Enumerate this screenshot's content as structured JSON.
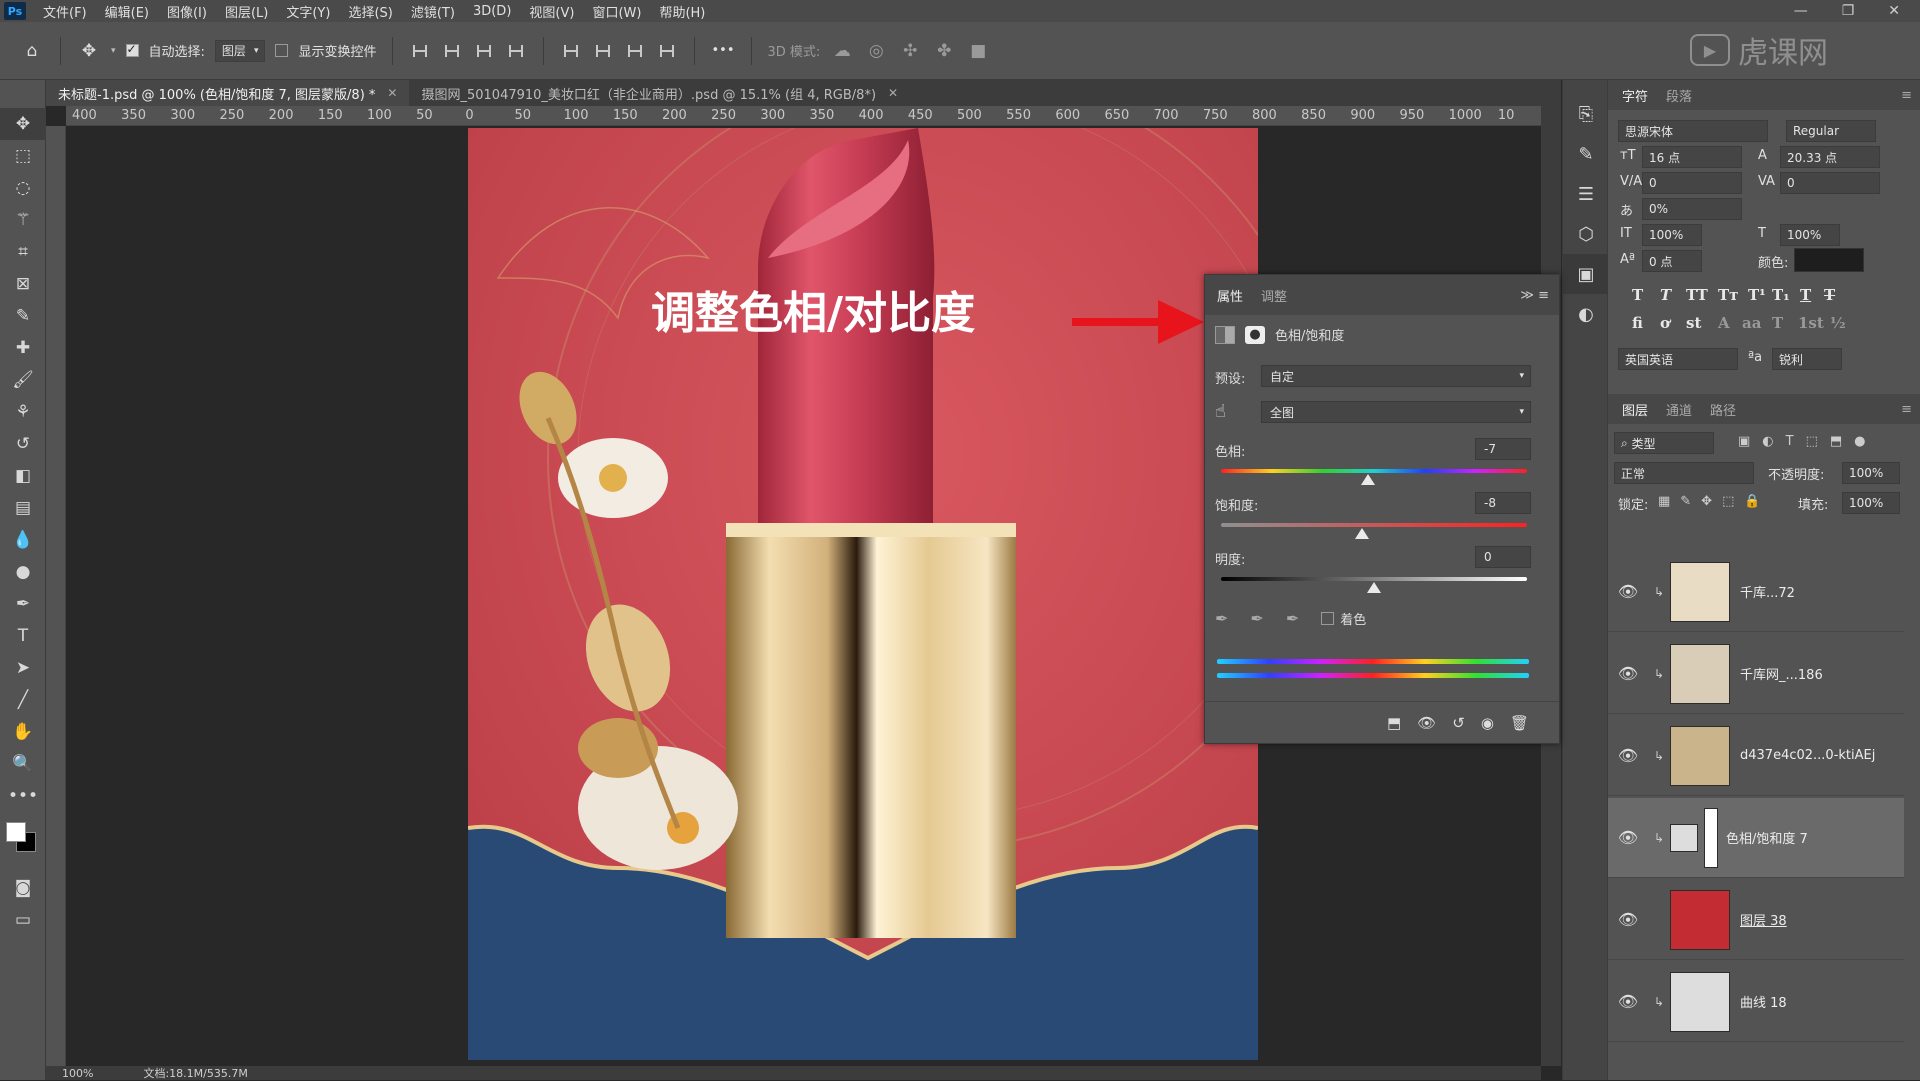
{
  "menu": {
    "logo": "Ps",
    "items": [
      "文件(F)",
      "编辑(E)",
      "图像(I)",
      "图层(L)",
      "文字(Y)",
      "选择(S)",
      "滤镜(T)",
      "3D(D)",
      "视图(V)",
      "窗口(W)",
      "帮助(H)"
    ],
    "window_buttons": [
      "—",
      "❐",
      "✕"
    ]
  },
  "options": {
    "auto_select_label": "自动选择:",
    "auto_select_checked": true,
    "auto_select_target": "图层",
    "show_transform_label": "显示变换控件",
    "show_transform_checked": false,
    "more": "•••",
    "mode_3d_label": "3D 模式:"
  },
  "watermark": "虎课网",
  "tabs": [
    {
      "label": "未标题-1.psd @ 100% (色相/饱和度 7, 图层蒙版/8) *",
      "active": true
    },
    {
      "label": "摄图网_501047910_美妆口红（非企业商用）.psd @ 15.1% (组 4, RGB/8*)",
      "active": false
    }
  ],
  "ruler": {
    "h_ticks": [
      "400",
      "350",
      "300",
      "250",
      "200",
      "150",
      "100",
      "50",
      "0",
      "50",
      "100",
      "150",
      "200",
      "250",
      "300",
      "350",
      "400",
      "450",
      "500",
      "550",
      "600",
      "650",
      "700",
      "750",
      "800",
      "850",
      "900",
      "950",
      "1000",
      "10"
    ]
  },
  "canvas": {
    "annotation": "调整色相/对比度",
    "arrow_color": "#e8141c"
  },
  "status": {
    "zoom": "100%",
    "doc": "文档:18.1M/535.7M"
  },
  "properties": {
    "tabs": [
      "属性",
      "调整"
    ],
    "title": "色相/饱和度",
    "preset_label": "预设:",
    "preset_value": "自定",
    "channel_value": "全图",
    "hue_label": "色相:",
    "hue_value": "-7",
    "hue": -7,
    "saturation_label": "饱和度:",
    "saturation_value": "-8",
    "saturation": -8,
    "lightness_label": "明度:",
    "lightness_value": "0",
    "lightness": 0,
    "colorize_label": "着色",
    "colorize_checked": false
  },
  "character": {
    "tabs": [
      "字符",
      "段落"
    ],
    "font_family": "思源宋体",
    "font_style": "Regular",
    "size": "16 点",
    "leading": "20.33 点",
    "kerning": "0",
    "tracking": "0",
    "scale_pct": "0%",
    "vscale": "100%",
    "hscale": "100%",
    "baseline": "0 点",
    "color_label": "颜色:",
    "language": "英国英语",
    "antialias_label": "ªa",
    "antialias": "锐利"
  },
  "layers_panel": {
    "tabs": [
      "图层",
      "通道",
      "路径"
    ],
    "filter": "类型",
    "blend": "正常",
    "opacity_label": "不透明度:",
    "opacity": "100%",
    "lock_label": "锁定:",
    "fill_label": "填充:",
    "fill": "100%",
    "layers": [
      {
        "name": "千库...72",
        "thumb": "#e8dcc4"
      },
      {
        "name": "千库网_...186",
        "thumb": "#d9cdb7"
      },
      {
        "name": "d437e4c02...0-ktiAEj",
        "thumb": "#c9b48c"
      },
      {
        "name": "色相/饱和度 7",
        "thumb": "#dddddd",
        "selected": true
      },
      {
        "name": "图层 38",
        "thumb": "#c42c33"
      },
      {
        "name": "曲线 18",
        "thumb": "#dddddd"
      }
    ]
  }
}
